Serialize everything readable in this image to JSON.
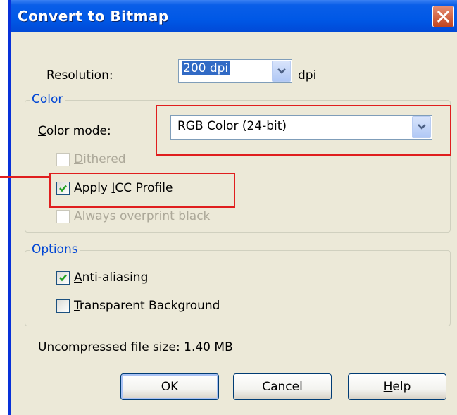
{
  "dialog": {
    "title": "Convert to Bitmap",
    "close_icon": "close-icon"
  },
  "resolution": {
    "label_underlined": "e",
    "label_pre": "R",
    "label_post": "solution:",
    "value": "200 dpi",
    "unit": "dpi"
  },
  "color_group": {
    "legend": "Color",
    "mode_label_pre": "",
    "mode_label_underlined": "C",
    "mode_label_post": "olor mode:",
    "mode_value": "RGB Color (24-bit)",
    "dithered": {
      "pre": "",
      "u": "D",
      "post": "ithered",
      "checked": false,
      "enabled": false
    },
    "apply_icc": {
      "pre": "Apply ",
      "u": "I",
      "post": "CC Profile",
      "checked": true,
      "enabled": true
    },
    "overprint": {
      "pre": "Always overprint ",
      "u": "b",
      "post": "lack",
      "checked": false,
      "enabled": false
    }
  },
  "options_group": {
    "legend": "Options",
    "anti_aliasing": {
      "pre": "",
      "u": "A",
      "post": "nti-aliasing",
      "checked": true
    },
    "transparent": {
      "pre": "",
      "u": "T",
      "post": "ransparent Background",
      "checked": false
    }
  },
  "file_size": "Uncompressed file size: 1.40 MB",
  "buttons": {
    "ok": "OK",
    "cancel": "Cancel",
    "help_u": "H",
    "help_post": "elp"
  },
  "colors": {
    "title_bar": "#0058e6",
    "face": "#ece9d8",
    "legend": "#0046d5",
    "annotation": "#e01e1e"
  }
}
